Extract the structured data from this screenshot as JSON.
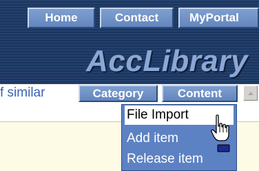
{
  "topnav": {
    "home": "Home",
    "contact": "Contact",
    "portal": "MyPortal"
  },
  "logo": "AccLibrary",
  "tabs": {
    "similar": "f similar",
    "category": "Category",
    "content": "Content"
  },
  "menu": {
    "items": [
      "File Import",
      "Add item",
      "Release item"
    ]
  },
  "colors": {
    "header_bg": "#23416e",
    "button_bg": "#6f92c8",
    "menu_bg": "#5d82c3",
    "logo": "#8ba7d6",
    "link": "#3a62b3",
    "panel_bg": "#fdfbe6"
  },
  "cursor": "hand-pointer-icon"
}
